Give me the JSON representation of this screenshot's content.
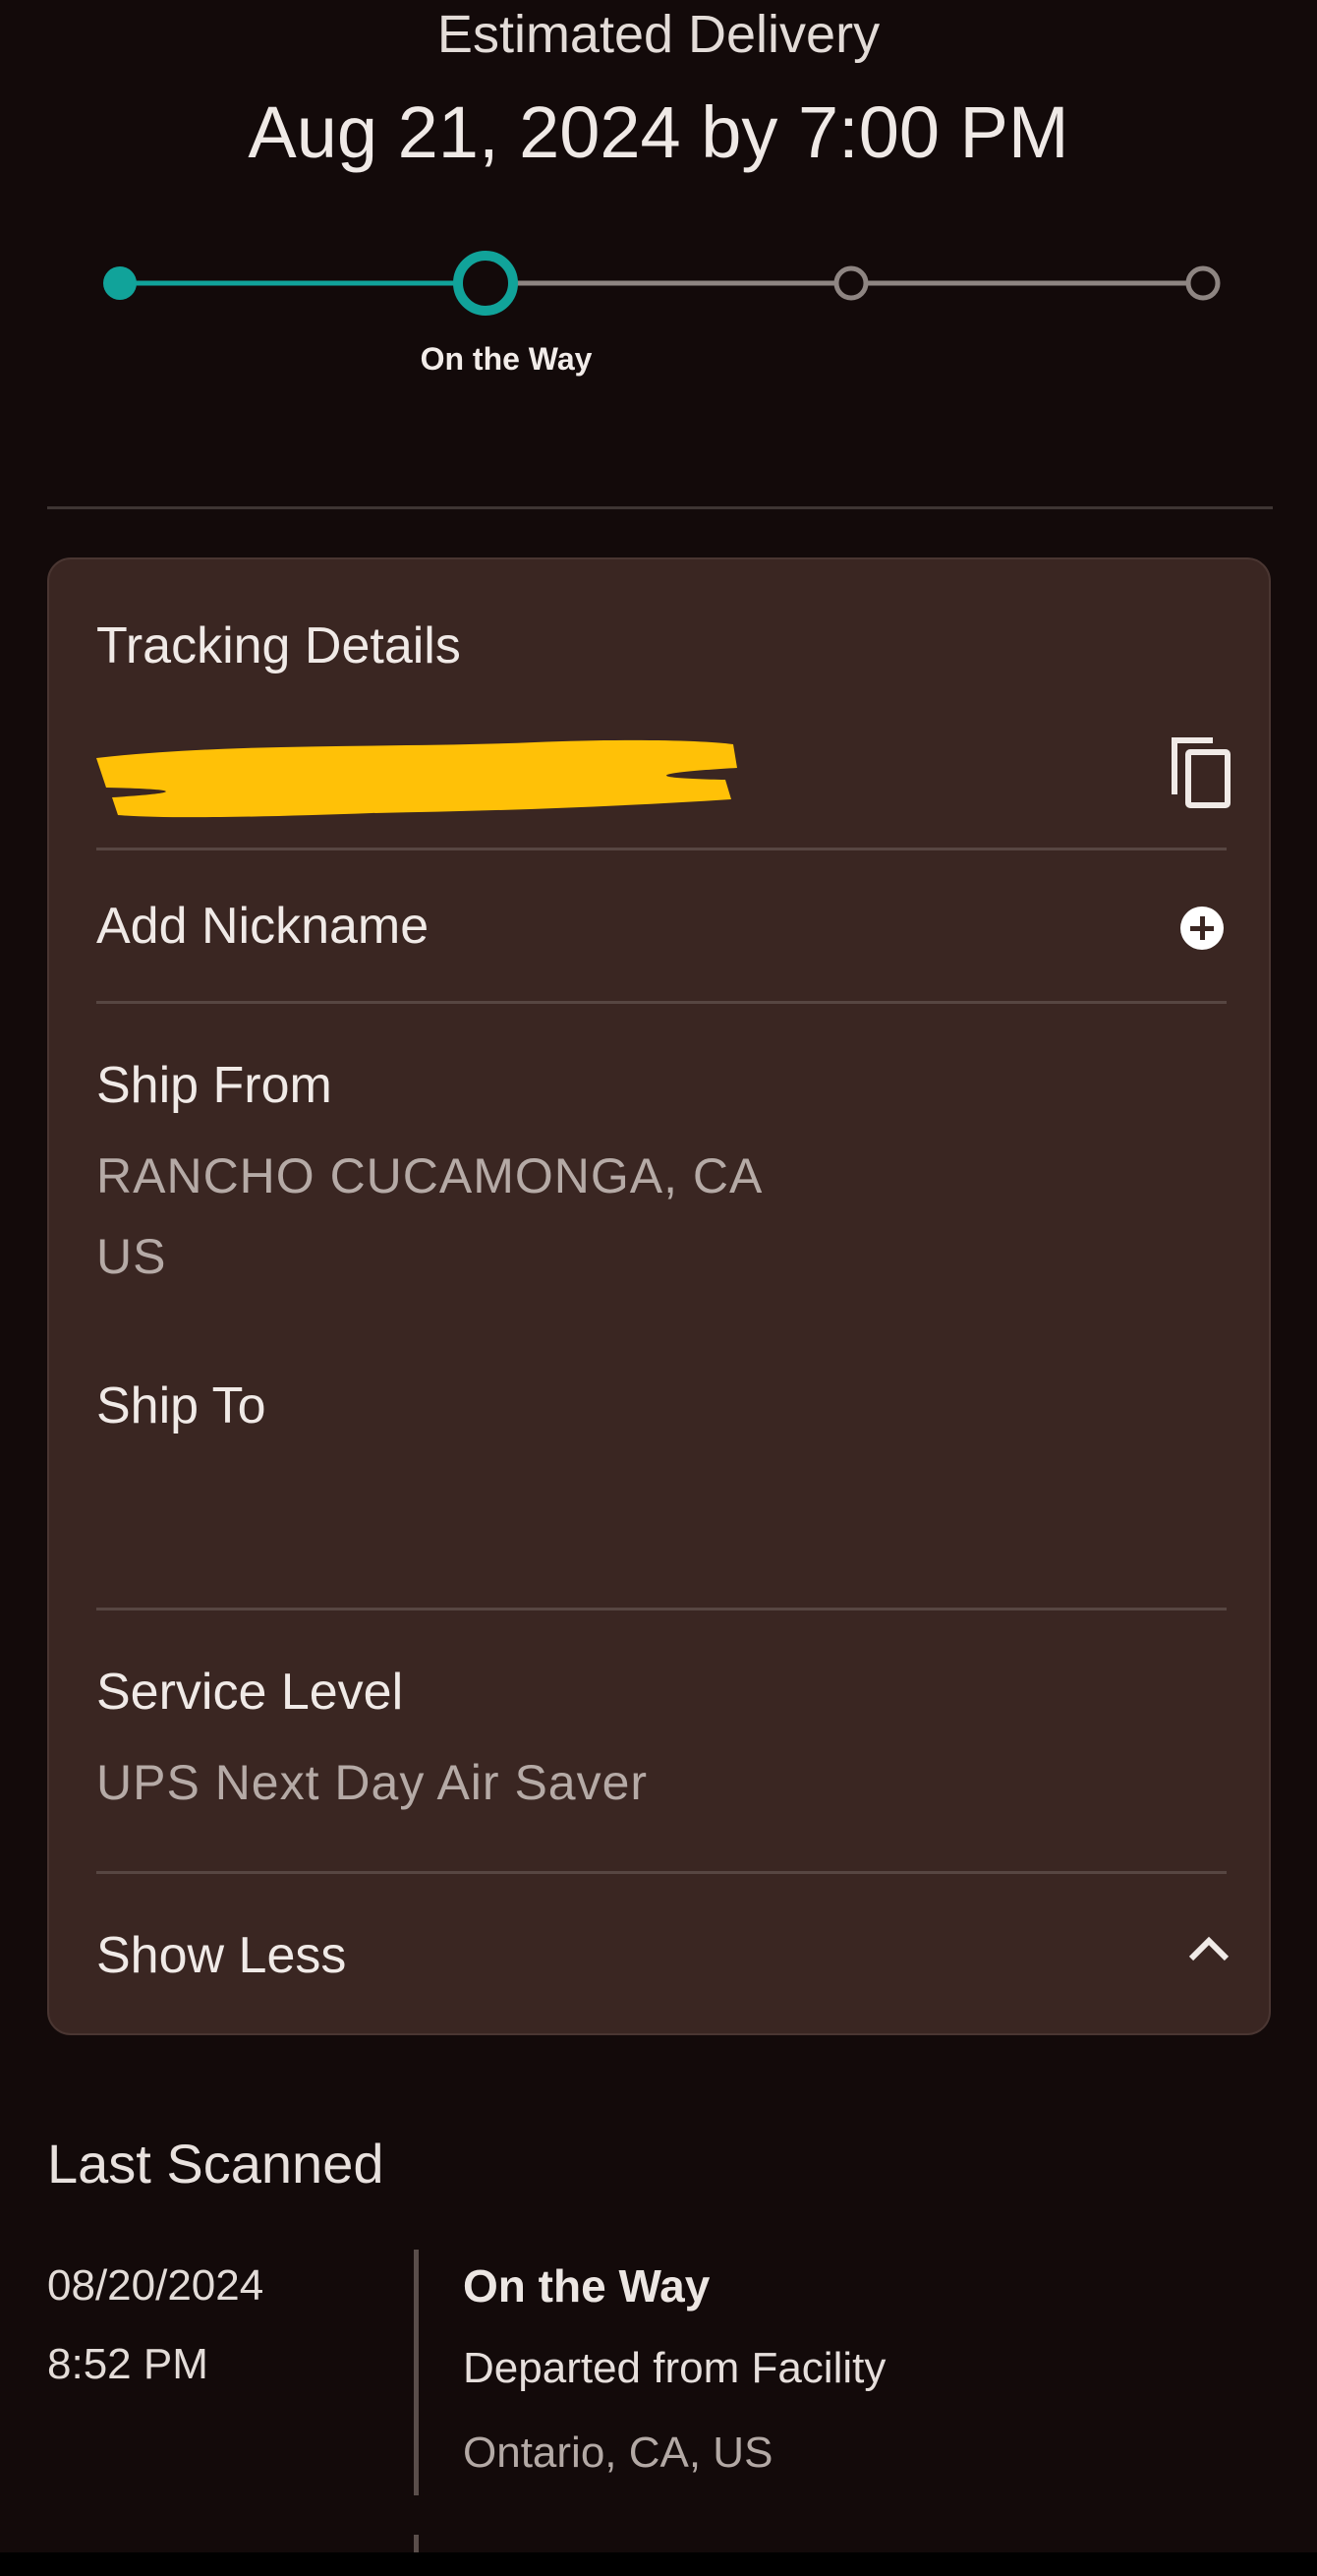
{
  "delivery": {
    "label": "Estimated Delivery",
    "date": "Aug 21, 2024 by 7:00 PM"
  },
  "progress": {
    "current_label": "On the Way",
    "steps_total": 4,
    "current_step": 2,
    "accent_color": "#11a39a",
    "inactive_color": "#8e8582"
  },
  "tracking": {
    "title": "Tracking Details",
    "add_nickname": "Add Nickname",
    "ship_from": {
      "label": "Ship From",
      "line1": "RANCHO CUCAMONGA, CA",
      "line2": "US"
    },
    "ship_to": {
      "label": "Ship To"
    },
    "service_level": {
      "label": "Service Level",
      "value": "UPS Next Day Air Saver"
    },
    "toggle_label": "Show Less",
    "redaction_color": "#ffc107",
    "icons": {
      "copy": "copy-icon",
      "add": "plus-circle-icon",
      "collapse": "chevron-up-icon"
    }
  },
  "last_scanned": {
    "title": "Last Scanned",
    "date": "08/20/2024",
    "time": "8:52 PM",
    "status": "On the Way",
    "description": "Departed from Facility",
    "location": "Ontario, CA, US"
  }
}
